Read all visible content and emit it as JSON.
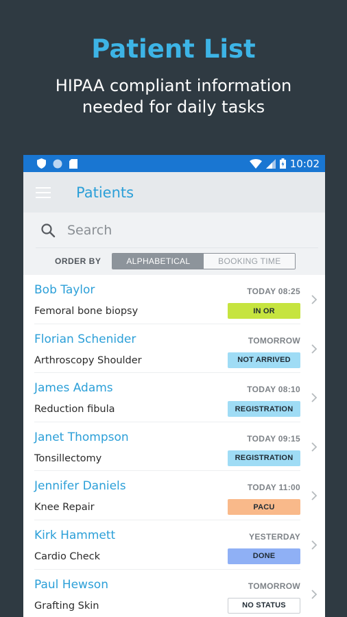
{
  "promo": {
    "title": "Patient List",
    "subtitle": "HIPAA compliant information needed for daily tasks"
  },
  "statusbar": {
    "time": "10:02"
  },
  "appbar": {
    "title": "Patients"
  },
  "search": {
    "placeholder": "Search"
  },
  "order": {
    "label": "ORDER BY",
    "options": [
      "ALPHABETICAL",
      "BOOKING TIME"
    ],
    "selected": "ALPHABETICAL"
  },
  "patients": [
    {
      "name": "Bob Taylor",
      "procedure": "Femoral bone biopsy",
      "time": "TODAY 08:25",
      "status": "IN OR",
      "status_color": "#c6e43f"
    },
    {
      "name": "Florian Schenider",
      "procedure": "Arthroscopy Shoulder",
      "time": "TOMORROW",
      "status": "NOT ARRIVED",
      "status_color": "#9fdcf5"
    },
    {
      "name": "James Adams",
      "procedure": "Reduction fibula",
      "time": "TODAY 08:10",
      "status": "REGISTRATION",
      "status_color": "#9fdcf5"
    },
    {
      "name": "Janet Thompson",
      "procedure": "Tonsillectomy",
      "time": "TODAY 09:15",
      "status": "REGISTRATION",
      "status_color": "#9fdcf5"
    },
    {
      "name": "Jennifer Daniels",
      "procedure": "Knee Repair",
      "time": "TODAY 11:00",
      "status": "PACU",
      "status_color": "#f9b98a"
    },
    {
      "name": "Kirk Hammett",
      "procedure": "Cardio Check",
      "time": "YESTERDAY",
      "status": "DONE",
      "status_color": "#8fb0f5"
    },
    {
      "name": "Paul Hewson",
      "procedure": "Grafting Skin",
      "time": "TOMORROW",
      "status": "NO STATUS",
      "status_color": "#ffffff"
    }
  ],
  "colors": {
    "accent": "#2b9fd8",
    "statusbar": "#1976d2",
    "background": "#2f3a42"
  },
  "icons": [
    "shield-icon",
    "circle-icon",
    "sd-card-icon",
    "wifi-icon",
    "signal-icon",
    "battery-icon",
    "menu-icon",
    "search-icon",
    "chevron-right-icon"
  ]
}
